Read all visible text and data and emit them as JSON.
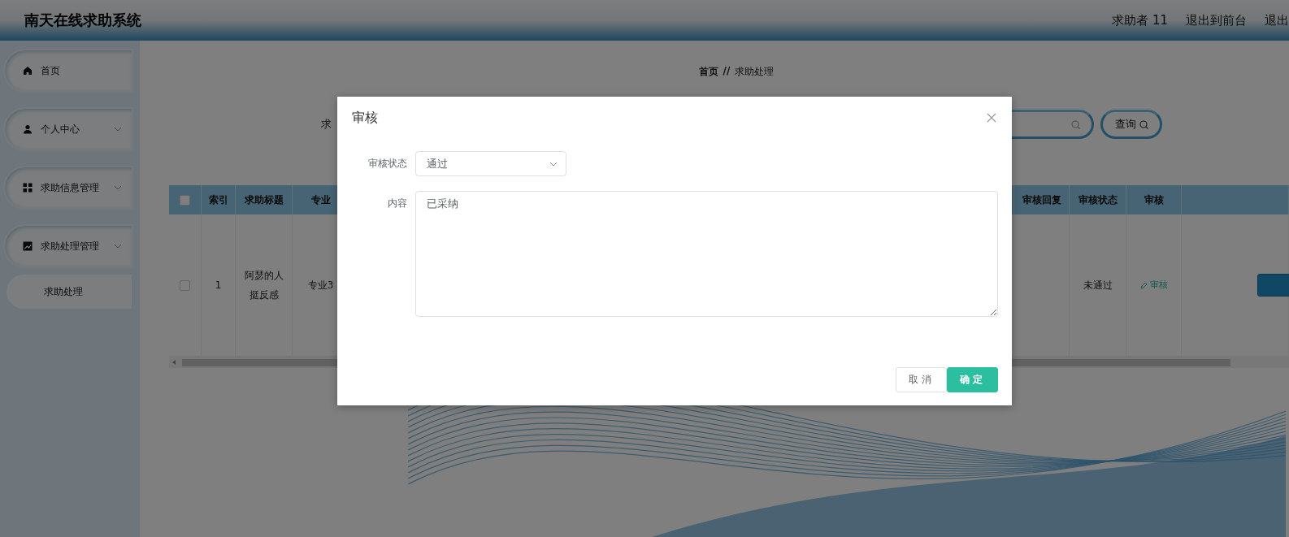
{
  "header": {
    "title": "南天在线求助系统",
    "links": [
      "求助者 11",
      "退出到前台",
      "退出"
    ]
  },
  "sidebar": {
    "items": [
      {
        "label": "首页",
        "kind": "home"
      },
      {
        "label": "个人中心",
        "kind": "user",
        "expandable": true
      },
      {
        "label": "求助信息管理",
        "kind": "grid",
        "expandable": true
      },
      {
        "label": "求助处理管理",
        "kind": "chart",
        "expandable": true,
        "children": [
          {
            "label": "求助处理",
            "selected": true
          }
        ]
      }
    ]
  },
  "breadcrumb": {
    "items": [
      "首页",
      "求助处理"
    ],
    "separator": "//"
  },
  "search": {
    "label": "求",
    "button": "查询"
  },
  "table": {
    "header_checked": false,
    "columns_left": [
      "索引",
      "求助标题",
      "专业"
    ],
    "columns_right": [
      "审核回复",
      "审核状态",
      "审核"
    ],
    "rows": [
      {
        "checked": false,
        "index": "1",
        "title": "阿瑟的人挺反感",
        "major": "专业3",
        "status": "未通过",
        "action": "审核"
      }
    ]
  },
  "modal": {
    "title": "审核",
    "fields": [
      {
        "kind": "select",
        "label": "审核状态",
        "value": "通过"
      },
      {
        "kind": "textarea",
        "label": "内容",
        "value": "已采纳"
      }
    ],
    "buttons": [
      {
        "label": "取消",
        "kind": "default"
      },
      {
        "label": "确定",
        "kind": "primary"
      }
    ]
  }
}
